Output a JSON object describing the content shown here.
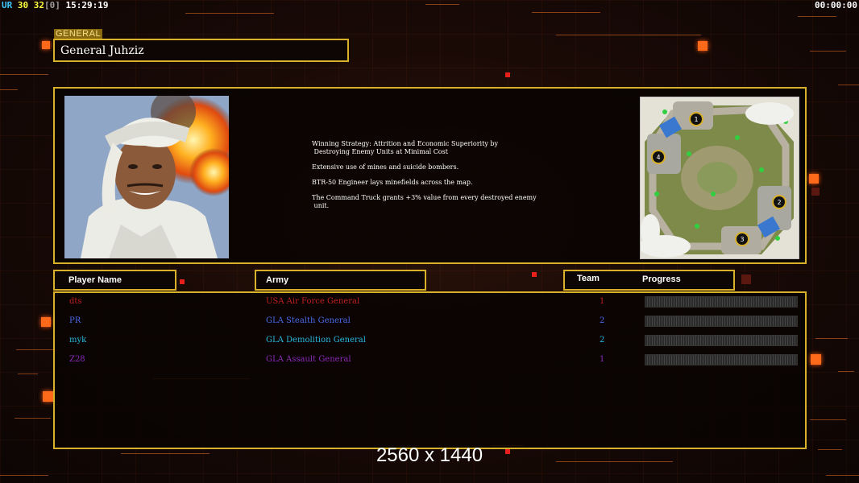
{
  "hud": {
    "left_segments": [
      {
        "text": "UR",
        "color": "#3ec8ff"
      },
      {
        "text": " 30",
        "color": "#ffff40"
      },
      {
        "text": " 32",
        "color": "#ffff40"
      },
      {
        "text": "[0]",
        "color": "#9a9a9a"
      },
      {
        "text": " 15:29:19",
        "color": "#ffffff"
      }
    ],
    "right": "00:00:00"
  },
  "general": {
    "tag": "GENERAL",
    "name": "General Juhziz",
    "strategy": [
      "Winning Strategy: Attrition and Economic Superiority by\n Destroying Enemy Units at Minimal Cost",
      "Extensive use of mines and suicide bombers.",
      "BTR-50 Engineer lays minefields across the map.",
      "The Command Truck grants +3% value from every destroyed enemy\n unit."
    ],
    "map_positions": [
      "1",
      "2",
      "3",
      "4"
    ]
  },
  "table": {
    "headers": {
      "player": "Player Name",
      "army": "Army",
      "team": "Team",
      "progress": "Progress"
    },
    "rows": [
      {
        "player": "dts",
        "army": "USA Air Force General",
        "team": "1",
        "color": "#c02020",
        "progress": 0
      },
      {
        "player": "PR",
        "army": "GLA Stealth General",
        "team": "2",
        "color": "#4a6ae8",
        "progress": 0
      },
      {
        "player": "myk",
        "army": "GLA Demolition General",
        "team": "2",
        "color": "#28b8e0",
        "progress": 0
      },
      {
        "player": "Z28",
        "army": "GLA Assault General",
        "team": "1",
        "color": "#8a2ab8",
        "progress": 0
      }
    ]
  },
  "resolution": "2560 x 1440",
  "colors": {
    "panel_border": "#d8b02a",
    "accent_orange": "#ff6a1a",
    "background": "#120806"
  }
}
